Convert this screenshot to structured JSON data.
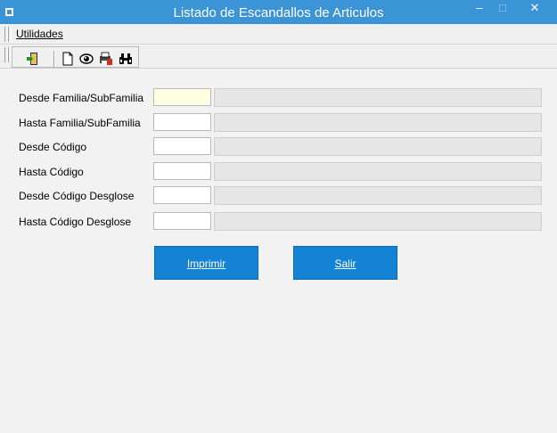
{
  "window": {
    "title": "Listado de Escandallos de Articulos",
    "minimize_glyph": "–",
    "maximize_glyph": "□",
    "close_glyph": "✕"
  },
  "menu": {
    "items": [
      {
        "label": "Utilidades",
        "icon": "none"
      }
    ]
  },
  "toolbar": {
    "buttons": [
      {
        "name": "exit-door-icon"
      },
      {
        "name": "new-document-icon"
      },
      {
        "name": "preview-eye-icon"
      },
      {
        "name": "print-setup-icon"
      },
      {
        "name": "binoculars-search-icon"
      }
    ]
  },
  "form": {
    "fields": [
      {
        "label": "Desde Familia/SubFamilia",
        "value": "",
        "description": ""
      },
      {
        "label": "Hasta Familia/SubFamilia",
        "value": "",
        "description": ""
      },
      {
        "label": "Desde Código",
        "value": "",
        "description": ""
      },
      {
        "label": "Hasta Código",
        "value": "",
        "description": ""
      },
      {
        "label": "Desde Código Desglose",
        "value": "",
        "description": ""
      },
      {
        "label": "Hasta Código Desglose",
        "value": "",
        "description": ""
      }
    ]
  },
  "actions": {
    "print_label": "Imprimir",
    "exit_label": "Salir"
  },
  "colors": {
    "titlebar": "#3b94d6",
    "button": "#1583d4",
    "active_field": "#ffffe1",
    "readonly_field": "#e6e6e6"
  }
}
